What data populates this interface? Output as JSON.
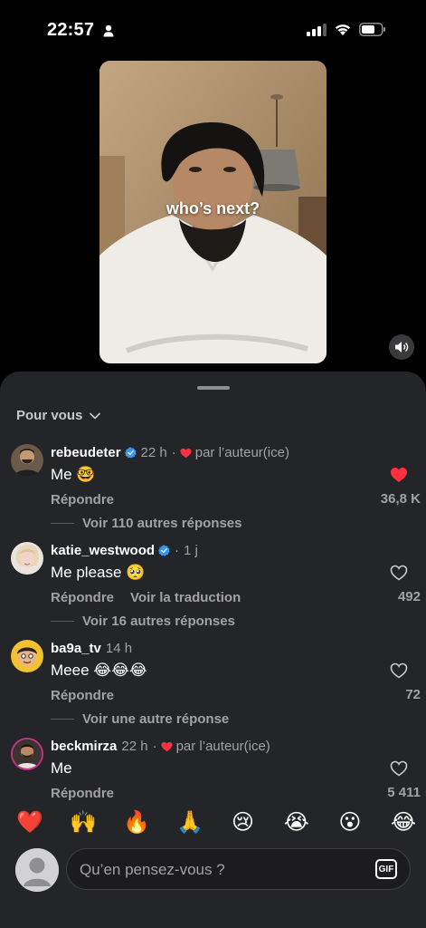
{
  "status": {
    "time": "22:57"
  },
  "video": {
    "caption": "who’s next?"
  },
  "comments_sheet": {
    "sort_label": "Pour vous",
    "comments": [
      {
        "username": "rebeudeter",
        "verified": true,
        "time": "22 h",
        "liked_by_author": true,
        "byline_separator": "·",
        "author_label": "par l’auteur(ice)",
        "text": "Me 🤓",
        "reply_label": "Répondre",
        "liked": true,
        "like_count": "36,8 K",
        "replies_label": "Voir 110 autres réponses"
      },
      {
        "username": "katie_westwood",
        "verified": true,
        "time": "1 j",
        "byline_separator": "·",
        "text": "Me please 🥺",
        "reply_label": "Répondre",
        "translate_label": "Voir la traduction",
        "liked": false,
        "like_count": "492",
        "replies_label": "Voir 16 autres réponses"
      },
      {
        "username": "ba9a_tv",
        "verified": false,
        "time": "14 h",
        "text": "Meee 😂😂😂",
        "reply_label": "Répondre",
        "liked": false,
        "like_count": "72",
        "replies_label": "Voir une autre réponse"
      },
      {
        "username": "beckmirza",
        "verified": false,
        "time": "22 h",
        "liked_by_author": true,
        "byline_separator": "·",
        "author_label": "par l’auteur(ice)",
        "text": "Me",
        "reply_label": "Répondre",
        "liked": false,
        "like_count": "5 411"
      }
    ],
    "emoji_reactions": [
      "❤️",
      "🙌",
      "🔥",
      "🙏",
      "😢",
      "😭",
      "😮",
      "😂"
    ],
    "input": {
      "placeholder": "Qu’en pensez-vous ?",
      "gif_label": "GIF"
    }
  },
  "colors": {
    "sheet_background": "#242528",
    "heart_red": "#ff3040",
    "verified_blue": "#3797f0",
    "secondary_text": "#a1a1a6"
  }
}
